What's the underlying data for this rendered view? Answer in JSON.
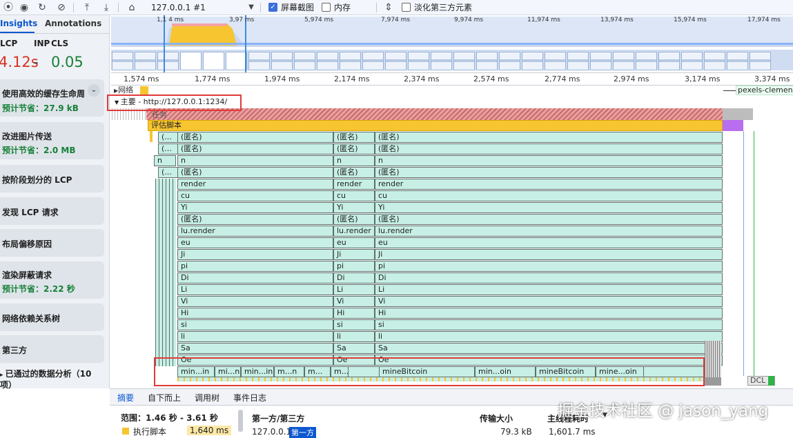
{
  "toolbar": {
    "session": "127.0.0.1 #1",
    "screenshots_label": "屏幕截图",
    "screenshots_checked": true,
    "memory_label": "内存",
    "memory_checked": false,
    "dim_third_party_label": "淡化第三方元素",
    "dim_third_party_checked": false
  },
  "sidebar": {
    "tabs": [
      "Insights",
      "Annotations"
    ],
    "metrics": {
      "lcp_label": "LCP",
      "lcp_value": "4.12s",
      "inp_label": "INP",
      "inp_value": "-",
      "cls_label": "CLS",
      "cls_value": "0.05"
    },
    "cards": [
      {
        "title": "使用高效的缓存生命周",
        "sub": "预计节省：27.9 kB"
      },
      {
        "title": "改进图片传送",
        "sub": "预计节省：2.0 MB"
      },
      {
        "title": "按阶段划分的 LCP",
        "sub": ""
      },
      {
        "title": "发现 LCP 请求",
        "sub": ""
      },
      {
        "title": "布局偏移原因",
        "sub": ""
      },
      {
        "title": "渲染屏蔽请求",
        "sub": "预计节省：2.22 秒"
      },
      {
        "title": "网络依赖关系树",
        "sub": ""
      },
      {
        "title": "第三方",
        "sub": ""
      }
    ],
    "passed_label": "已通过的数据分析（10",
    "passed_label_line2": "项）"
  },
  "overview": {
    "ticks": [
      "1,974 ms",
      "3,97 ms",
      "5,974 ms",
      "7,974 ms",
      "9,974 ms",
      "11,974 ms",
      "13,974 ms",
      "15,974 ms",
      "17,974 ms"
    ],
    "selection_left_label": "1,1 4 ms"
  },
  "ruler": {
    "ticks": [
      "1,574 ms",
      "1,774 ms",
      "1,974 ms",
      "2,174 ms",
      "2,374 ms",
      "2,574 ms",
      "2,774 ms",
      "2,974 ms",
      "3,174 ms",
      "3,374 ms"
    ]
  },
  "tracks": {
    "network_label": "网络",
    "main_label": "主要 - http://127.0.0.1:1234/",
    "task_label": "任务",
    "evaluate_label": "评估脚本",
    "side_label": "pexels-clement",
    "dcl_label": "DCL"
  },
  "flame": {
    "col_left": [
      "(...",
      "(...",
      "n",
      "(..."
    ],
    "col_a": [
      "(匿名)",
      "(匿名)",
      "n",
      "(匿名)",
      "render",
      "cu",
      "Yi",
      "(匿名)",
      "lu.render",
      "eu",
      "Ji",
      "pi",
      "Di",
      "Li",
      "Vi",
      "Hi",
      "si",
      "li",
      "Sa",
      "Oe"
    ],
    "col_b": [
      "(匿名)",
      "(匿名)",
      "n",
      "(匿名)",
      "render",
      "cu",
      "Yi",
      "(匿名)",
      "lu.render",
      "eu",
      "Ji",
      "pi",
      "Di",
      "Li",
      "Vi",
      "Hi",
      "si",
      "li",
      "Sa",
      "Oe"
    ],
    "col_c": [
      "(匿名)",
      "(匿名)",
      "n",
      "(匿名)",
      "render",
      "cu",
      "Yi",
      "(匿名)",
      "lu.render",
      "eu",
      "Ji",
      "pi",
      "Di",
      "Li",
      "Vi",
      "Hi",
      "si",
      "li",
      "Sa",
      "Oe"
    ],
    "bottom_row": [
      "min...in",
      "mi...n",
      "min...in",
      "m...n",
      "m...",
      "m...",
      "mineBitcoin",
      "min...oin",
      "mineBitcoin",
      "mine...oin"
    ]
  },
  "bottom_tabs": [
    "摘要",
    "自下而上",
    "调用树",
    "事件日志"
  ],
  "summary": {
    "range_label": "范围：1.46 秒 - 3.61 秒",
    "exec_label": "执行脚本",
    "exec_value": "1,640 ms",
    "col1": "第一方/第三方",
    "col2": "传输大小",
    "col3": "主线程耗时",
    "row_host": "127.0.0.1",
    "row_badge": "第一方",
    "row_size": "79.3 kB",
    "row_time": "1,601.7 ms"
  },
  "watermark": "掘金技术社区 @ jason_yang",
  "colors": {
    "accent": "#0b57d0",
    "good": "#188038",
    "poor": "#d93025",
    "flame": "#c7efe5",
    "script": "#f7c530",
    "highlight": "#e03a3a"
  }
}
